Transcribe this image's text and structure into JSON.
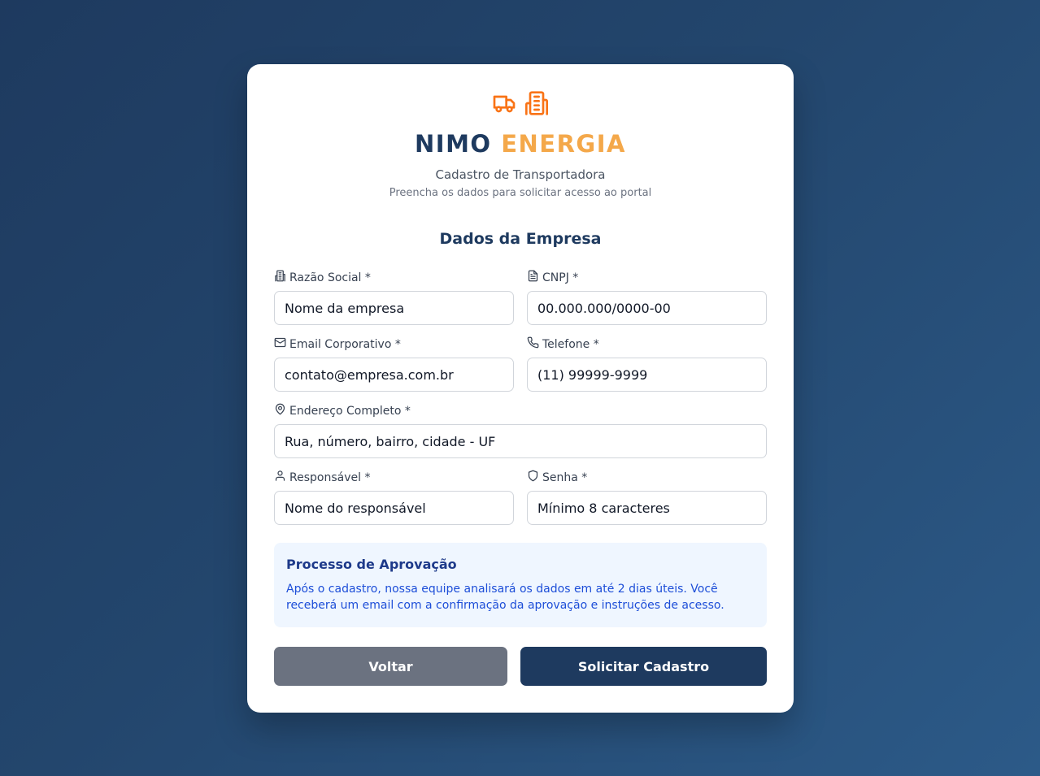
{
  "header": {
    "brand_primary": "NIMO",
    "brand_accent": "ENERGIA",
    "subtitle": "Cadastro de Transportadora",
    "hint": "Preencha os dados para solicitar acesso ao portal",
    "icons": [
      "truck-icon",
      "building-icon"
    ]
  },
  "form": {
    "section_title": "Dados da Empresa",
    "fields": {
      "razao_social": {
        "label": "Razão Social *",
        "placeholder": "Nome da empresa",
        "icon": "building-icon"
      },
      "cnpj": {
        "label": "CNPJ *",
        "placeholder": "00.000.000/0000-00",
        "icon": "document-icon"
      },
      "email": {
        "label": "Email Corporativo *",
        "placeholder": "contato@empresa.com.br",
        "icon": "mail-icon"
      },
      "telefone": {
        "label": "Telefone *",
        "placeholder": "(11) 99999-9999",
        "icon": "phone-icon"
      },
      "endereco": {
        "label": "Endereço Completo *",
        "placeholder": "Rua, número, bairro, cidade - UF",
        "icon": "map-pin-icon"
      },
      "responsavel": {
        "label": "Responsável *",
        "placeholder": "Nome do responsável",
        "icon": "user-icon"
      },
      "senha": {
        "label": "Senha *",
        "placeholder": "Mínimo 8 caracteres",
        "icon": "shield-icon"
      }
    }
  },
  "info": {
    "title": "Processo de Aprovação",
    "text": "Após o cadastro, nossa equipe analisará os dados em até 2 dias úteis. Você receberá um email com a confirmação da aprovação e instruções de acesso."
  },
  "actions": {
    "back_label": "Voltar",
    "submit_label": "Solicitar Cadastro"
  },
  "colors": {
    "brand_navy": "#1e3a5f",
    "brand_orange": "#f4a84a",
    "icon_orange": "#f97316",
    "back_button": "#6b7280",
    "info_bg": "#eff6ff"
  }
}
